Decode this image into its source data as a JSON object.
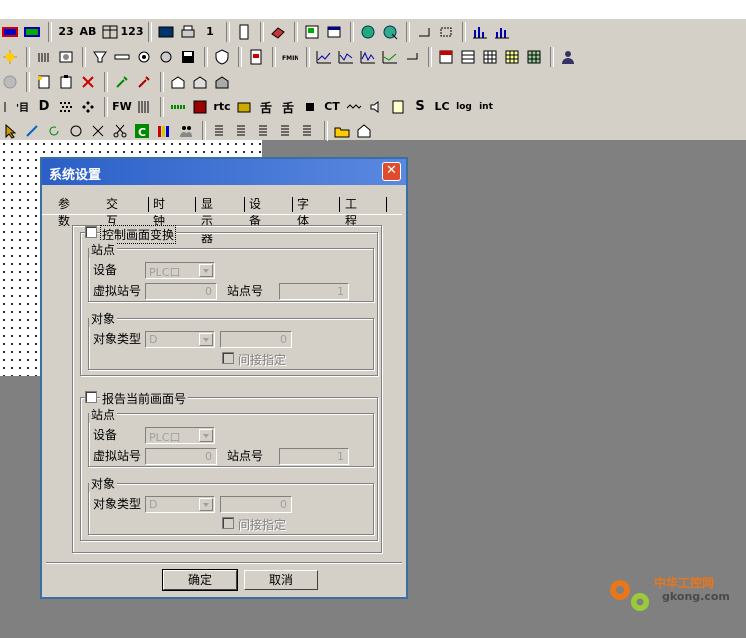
{
  "dialog": {
    "title": "系统设置",
    "close_glyph": "✕",
    "tabs": [
      "参数",
      "交互",
      "时钟",
      "显示器",
      "设备",
      "字体",
      "工程"
    ],
    "active_tab": "交互",
    "section1": {
      "checkbox_label": "控制画面变换",
      "station_group": "站点",
      "device_label": "设备",
      "device_value": "PLC口",
      "virtual_station_label": "虚拟站号",
      "virtual_station_value": "0",
      "station_no_label": "站点号",
      "station_no_value": "1",
      "object_group": "对象",
      "object_type_label": "对象类型",
      "object_type_value": "D",
      "object_value": "0",
      "indirect_label": "间接指定"
    },
    "section2": {
      "checkbox_label": "报告当前画面号",
      "station_group": "站点",
      "device_label": "设备",
      "device_value": "PLC口",
      "virtual_station_label": "虚拟站号",
      "virtual_station_value": "0",
      "station_no_label": "站点号",
      "station_no_value": "1",
      "object_group": "对象",
      "object_type_label": "对象类型",
      "object_type_value": "D",
      "object_value": "0",
      "indirect_label": "间接指定"
    },
    "ok_label": "确定",
    "cancel_label": "取消"
  },
  "toolbar": {
    "row3_text": [
      "D",
      "FW",
      "rtc",
      "CT",
      "S",
      "LC",
      "log",
      "int"
    ],
    "row1_text": [
      "23",
      "AB",
      "123",
      "1"
    ],
    "row5_text": [
      "C"
    ]
  },
  "watermark": {
    "site_cn": "中华工控网",
    "site_url": "gkong.com"
  },
  "colors": {
    "titlebar": "#2b5fc7",
    "close": "#e04c2c",
    "face": "#d4d0c8",
    "workspace": "#808080"
  }
}
